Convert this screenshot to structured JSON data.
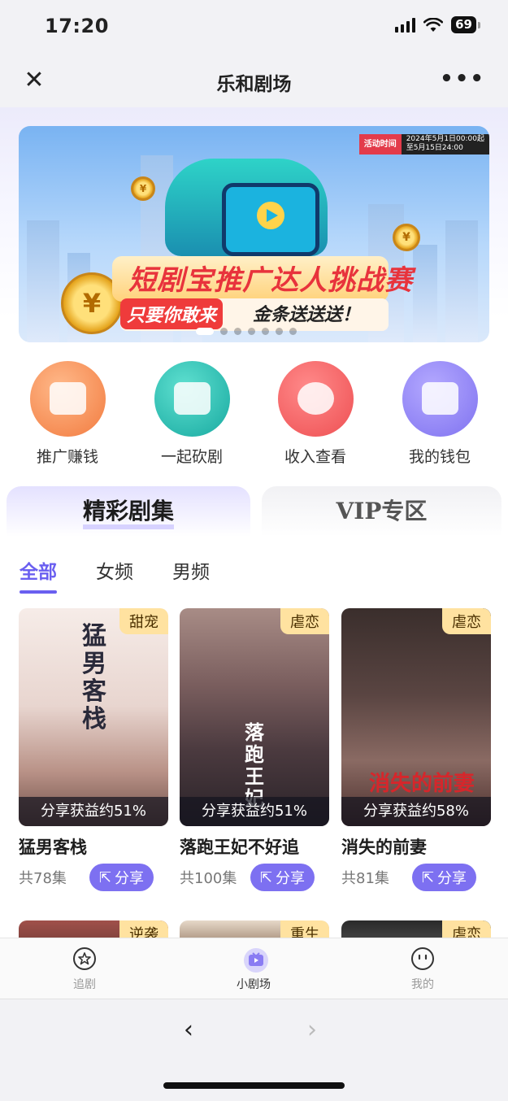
{
  "status": {
    "time": "17:20",
    "battery": "69"
  },
  "nav": {
    "title": "乐和剧场"
  },
  "banner": {
    "activity_label": "活动时间",
    "activity_dates": [
      "2024年5月1日00:00起",
      "至5月15日24:00"
    ],
    "title": "短剧宝推广达人挑战赛",
    "sub_highlight": "只要你敢来",
    "sub_rest": "金条送送送！",
    "dot_count": 7,
    "active_dot": 0
  },
  "quick_actions": [
    {
      "label": "推广赚钱",
      "icon": "promote-icon"
    },
    {
      "label": "一起砍剧",
      "icon": "tv-icon"
    },
    {
      "label": "收入查看",
      "icon": "piggy-bank-icon"
    },
    {
      "label": "我的钱包",
      "icon": "wallet-icon"
    }
  ],
  "tabs": {
    "active": "精彩剧集",
    "inactive": "VIP专区"
  },
  "categories": [
    "全部",
    "女频",
    "男频"
  ],
  "dramas": [
    {
      "genre": "甜宠",
      "poster_title": "猛男客栈",
      "share_rate": "分享获益约51%",
      "name": "猛男客栈",
      "episodes": "共78集",
      "share": "分享"
    },
    {
      "genre": "虐恋",
      "poster_title": "落跑王妃",
      "share_rate": "分享获益约51%",
      "name": "落跑王妃不好追",
      "episodes": "共100集",
      "share": "分享"
    },
    {
      "genre": "虐恋",
      "poster_title": "消失的前妻",
      "share_rate": "分享获益约58%",
      "name": "消失的前妻",
      "episodes": "共81集",
      "share": "分享"
    }
  ],
  "next_row_genres": [
    "逆袭",
    "重生",
    "虐恋"
  ],
  "tabbar": [
    {
      "label": "追剧",
      "icon": "star-circle-icon"
    },
    {
      "label": "小剧场",
      "icon": "tv-face-icon"
    },
    {
      "label": "我的",
      "icon": "smile-face-icon"
    }
  ],
  "bottom": {
    "back": "‹",
    "forward": "›"
  }
}
